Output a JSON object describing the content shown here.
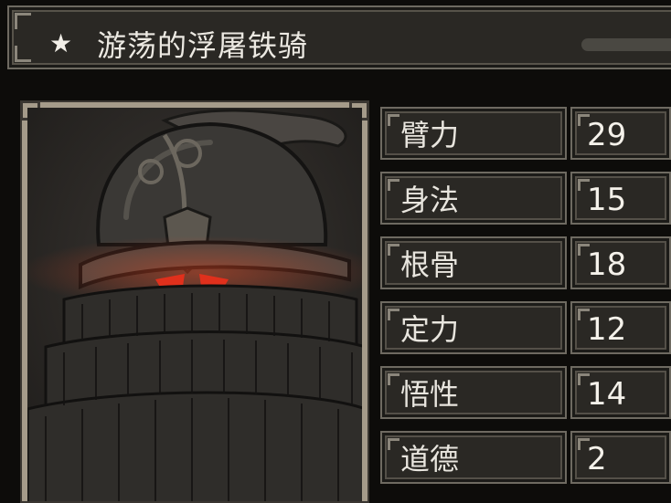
{
  "title": {
    "star": "★",
    "name": "游荡的浮屠铁骑"
  },
  "portrait": {
    "subject": "armored-helmet-warrior",
    "eye_color": "#e0301c"
  },
  "stats": [
    {
      "label": "臂力",
      "value": "29"
    },
    {
      "label": "身法",
      "value": "15"
    },
    {
      "label": "根骨",
      "value": "18"
    },
    {
      "label": "定力",
      "value": "12"
    },
    {
      "label": "悟性",
      "value": "14"
    },
    {
      "label": "道德",
      "value": "2"
    }
  ]
}
